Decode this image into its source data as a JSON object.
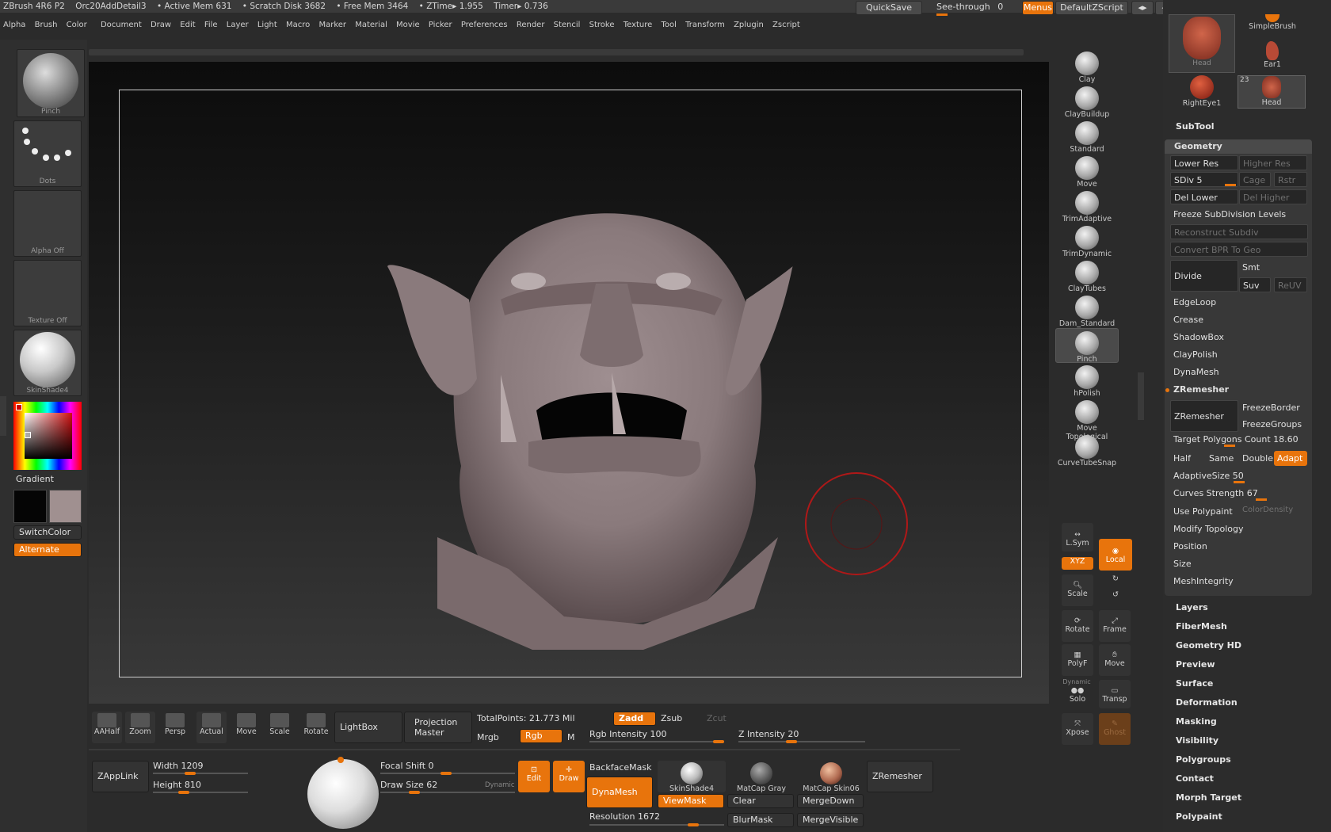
{
  "title": {
    "app": "ZBrush 4R6 P2",
    "document": "Orc20AddDetail3",
    "active_mem": "• Active Mem 631",
    "scratch_disk": "• Scratch Disk 3682",
    "free_mem": "• Free Mem 3464",
    "ztime": "• ZTime▸ 1.955",
    "timer": "Timer▸ 0.736"
  },
  "topright": {
    "quicksave": "QuickSave",
    "seethrough": "See-through",
    "seethrough_value": "0",
    "menus": "Menus",
    "default_zscript": "DefaultZScript"
  },
  "menubar": [
    "Alpha",
    "Brush",
    "Color",
    "Document",
    "Draw",
    "Edit",
    "File",
    "Layer",
    "Light",
    "Macro",
    "Marker",
    "Material",
    "Movie",
    "Picker",
    "Preferences",
    "Render",
    "Stencil",
    "Stroke",
    "Texture",
    "Tool",
    "Transform",
    "Zplugin",
    "Zscript"
  ],
  "leftshelf": {
    "brush": "Pinch",
    "stroke": "Dots",
    "alpha": "Alpha Off",
    "texture": "Texture Off",
    "material": "SkinShade4",
    "gradient": "Gradient",
    "switchcolor": "SwitchColor",
    "alternate": "Alternate"
  },
  "brushes": [
    "Clay",
    "ClayBuildup",
    "Standard",
    "Move",
    "TrimAdaptive",
    "TrimDynamic",
    "ClayTubes",
    "Dam_Standard",
    "Pinch",
    "hPolish",
    "Move Topological",
    "CurveTubeSnap"
  ],
  "navtools": {
    "lsym": "L.Sym",
    "xyz": "XYZ",
    "local": "Local",
    "scale": "Scale",
    "rotate": "Rotate",
    "frame": "Frame",
    "polyf": "PolyF",
    "move": "Move",
    "dynamic": "Dynamic",
    "solo": "Solo",
    "transp": "Transp",
    "xpose": "Xpose",
    "ghost": "Ghost"
  },
  "subtools": {
    "items": [
      "Head",
      "SimpleBrush",
      "Ear1",
      "RightEye1",
      "Head"
    ],
    "count": "23"
  },
  "rightpanel": {
    "subtool": "SubTool",
    "geometry": "Geometry",
    "lower_res": "Lower Res",
    "higher_res": "Higher Res",
    "sdiv": "SDiv 5",
    "cage": "Cage",
    "rstr": "Rstr",
    "del_lower": "Del Lower",
    "del_higher": "Del Higher",
    "freeze_subdiv": "Freeze SubDivision Levels",
    "reconstruct": "Reconstruct Subdiv",
    "convert_bpr": "Convert BPR To Geo",
    "divide": "Divide",
    "smt": "Smt",
    "suv": "Suv",
    "reuv": "ReUV",
    "edgeloop": "EdgeLoop",
    "crease": "Crease",
    "shadowbox": "ShadowBox",
    "claypolish": "ClayPolish",
    "dynamesh": "DynaMesh",
    "zremesher_header": "ZRemesher",
    "zremesher_btn": "ZRemesher",
    "freezeborder": "FreezeBorder",
    "freezegroups": "FreezeGroups",
    "target_poly": "Target Polygons Count 18.60",
    "half": "Half",
    "same": "Same",
    "double": "Double",
    "adapt": "Adapt",
    "adaptivesize": "AdaptiveSize 50",
    "curves_strength": "Curves Strength 67",
    "use_polypaint": "Use Polypaint",
    "colordensity": "ColorDensity",
    "modify_topology": "Modify Topology",
    "position": "Position",
    "size": "Size",
    "meshintegrity": "MeshIntegrity",
    "menus": [
      "Layers",
      "FiberMesh",
      "Geometry HD",
      "Preview",
      "Surface",
      "Deformation",
      "Masking",
      "Visibility",
      "Polygroups",
      "Contact",
      "Morph Target",
      "Polypaint"
    ]
  },
  "bottom": {
    "aahalf": "AAHalf",
    "zoom": "Zoom",
    "persp": "Persp",
    "actual": "Actual",
    "move": "Move",
    "scale": "Scale",
    "rotate": "Rotate",
    "lightbox": "LightBox",
    "projection_master": "Projection Master",
    "totalpoints": "TotalPoints: 21.773 Mil",
    "zadd": "Zadd",
    "zsub": "Zsub",
    "zcut": "Zcut",
    "mrgb": "Mrgb",
    "rgb": "Rgb",
    "m": "M",
    "rgb_intensity": "Rgb Intensity 100",
    "z_intensity": "Z Intensity 20",
    "zapplink": "ZAppLink",
    "width": "Width 1209",
    "height": "Height 810",
    "focal_shift": "Focal Shift 0",
    "draw_size": "Draw Size 62",
    "dynamic": "Dynamic",
    "edit": "Edit",
    "draw": "Draw",
    "backfacemask": "BackfaceMask",
    "dynamesh": "DynaMesh",
    "resolution": "Resolution 1672",
    "skinshade4": "SkinShade4",
    "matcap_gray": "MatCap Gray",
    "matcap_skin06": "MatCap Skin06",
    "zremesher": "ZRemesher",
    "viewmask": "ViewMask",
    "clear": "Clear",
    "mergedown": "MergeDown",
    "blurmask": "BlurMask",
    "mergevisible": "MergeVisible"
  },
  "colors": {
    "accent": "#e8740c",
    "panel_bg": "#2c2c2c",
    "model": "#8c7b7d"
  }
}
